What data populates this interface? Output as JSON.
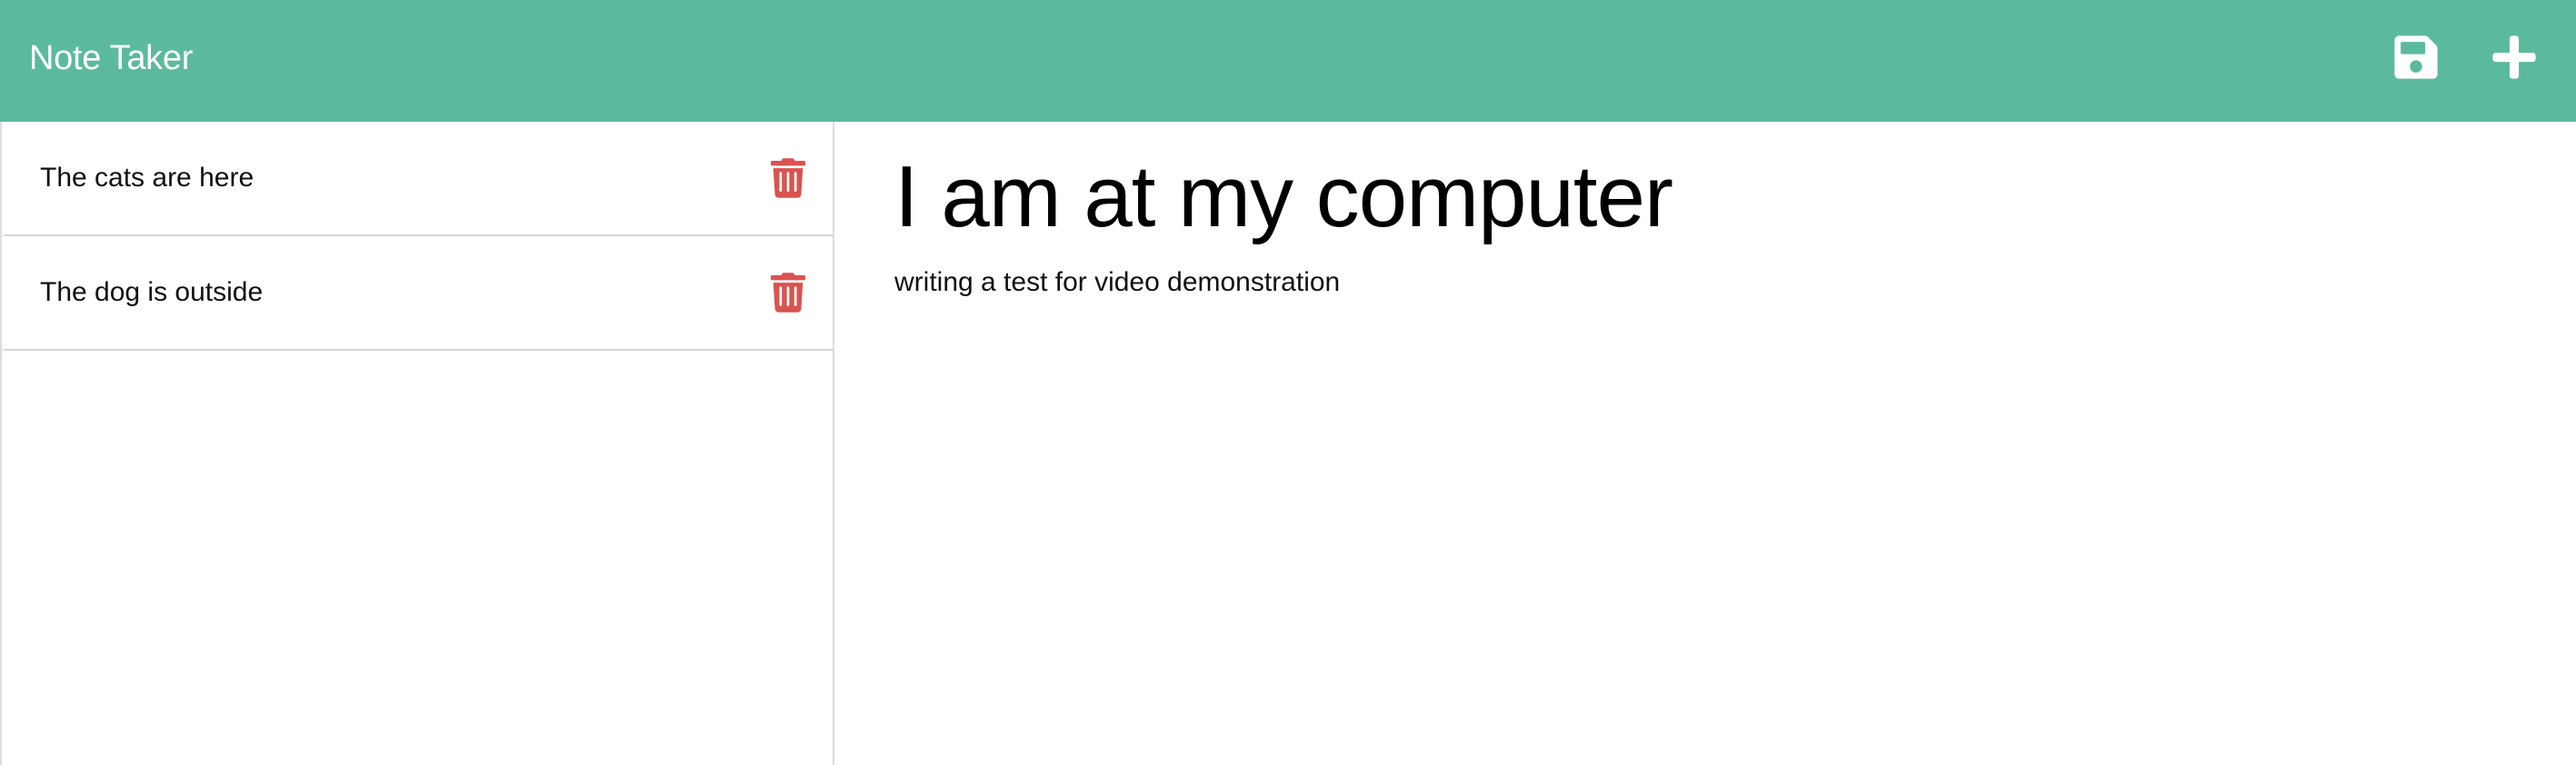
{
  "navbar": {
    "title": "Note Taker",
    "save_icon": "save-icon",
    "new_icon": "plus-icon",
    "color": "#5bba9d"
  },
  "notes": [
    {
      "title": "The cats are here",
      "delete_icon": "trash-icon"
    },
    {
      "title": "The dog is outside",
      "delete_icon": "trash-icon"
    }
  ],
  "editor": {
    "title": "I am at my computer",
    "text": "writing a test for video demonstration"
  },
  "colors": {
    "accent": "#5bba9d",
    "delete": "#d9534f"
  }
}
